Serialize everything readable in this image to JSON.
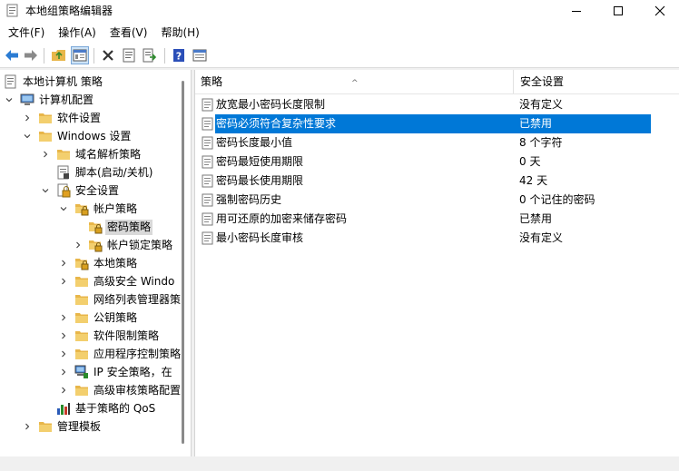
{
  "window": {
    "title": "本地组策略编辑器"
  },
  "menu": [
    {
      "label": "文件(F)"
    },
    {
      "label": "操作(A)"
    },
    {
      "label": "查看(V)"
    },
    {
      "label": "帮助(H)"
    }
  ],
  "toolbar": {
    "icons": [
      "back-icon",
      "forward-icon",
      "up-folder-icon",
      "show-hide-tree-icon",
      "delete-icon",
      "properties-icon",
      "export-list-icon",
      "help-icon",
      "view-icon"
    ]
  },
  "tree": [
    {
      "label": "本地计算机 策略",
      "icon": "computer-policy-icon",
      "chevron": "none"
    },
    {
      "label": "计算机配置",
      "icon": "computer-icon",
      "chevron": "expanded"
    },
    {
      "label": "软件设置",
      "icon": "folder-icon",
      "chevron": "collapsed"
    },
    {
      "label": "Windows 设置",
      "icon": "folder-icon",
      "chevron": "expanded"
    },
    {
      "label": "域名解析策略",
      "icon": "folder-icon",
      "chevron": "collapsed"
    },
    {
      "label": "脚本(启动/关机)",
      "icon": "script-icon",
      "chevron": "none"
    },
    {
      "label": "安全设置",
      "icon": "security-icon",
      "chevron": "expanded"
    },
    {
      "label": "帐户策略",
      "icon": "folder-lock-icon",
      "chevron": "expanded"
    },
    {
      "label": "密码策略",
      "icon": "folder-lock-icon",
      "chevron": "none",
      "selected": true
    },
    {
      "label": "帐户锁定策略",
      "icon": "folder-lock-icon",
      "chevron": "collapsed"
    },
    {
      "label": "本地策略",
      "icon": "folder-lock-icon",
      "chevron": "collapsed"
    },
    {
      "label": "高级安全 Windo",
      "icon": "folder-icon",
      "chevron": "collapsed"
    },
    {
      "label": "网络列表管理器策",
      "icon": "folder-icon",
      "chevron": "none"
    },
    {
      "label": "公钥策略",
      "icon": "folder-icon",
      "chevron": "collapsed"
    },
    {
      "label": "软件限制策略",
      "icon": "folder-icon",
      "chevron": "collapsed"
    },
    {
      "label": "应用程序控制策略",
      "icon": "folder-icon",
      "chevron": "collapsed"
    },
    {
      "label": "IP 安全策略，在",
      "icon": "ip-security-icon",
      "chevron": "collapsed"
    },
    {
      "label": "高级审核策略配置",
      "icon": "folder-icon",
      "chevron": "collapsed"
    },
    {
      "label": "基于策略的 QoS",
      "icon": "qos-chart-icon",
      "chevron": "collapsed"
    },
    {
      "label": "管理模板",
      "icon": "folder-icon",
      "chevron": "collapsed"
    }
  ],
  "list": {
    "col_policy": "策略",
    "col_setting": "安全设置",
    "rows": [
      {
        "name": "放宽最小密码长度限制",
        "value": "没有定义",
        "icon": "policy-item-icon"
      },
      {
        "name": "密码必须符合复杂性要求",
        "value": "已禁用",
        "icon": "policy-item-icon",
        "selected": true
      },
      {
        "name": "密码长度最小值",
        "value": "8 个字符",
        "icon": "policy-item-icon"
      },
      {
        "name": "密码最短使用期限",
        "value": "0 天",
        "icon": "policy-item-icon"
      },
      {
        "name": "密码最长使用期限",
        "value": "42 天",
        "icon": "policy-item-icon"
      },
      {
        "name": "强制密码历史",
        "value": "0 个记住的密码",
        "icon": "policy-item-icon"
      },
      {
        "name": "用可还原的加密来储存密码",
        "value": "已禁用",
        "icon": "policy-item-icon"
      },
      {
        "name": "最小密码长度审核",
        "value": "没有定义",
        "icon": "policy-item-icon"
      }
    ]
  },
  "colors": {
    "selection": "#0078d7",
    "tree_selection": "#d9d9d9",
    "folder": "#e8b64a"
  }
}
